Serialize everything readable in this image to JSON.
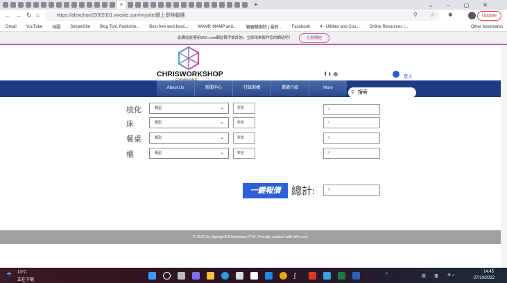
{
  "browser": {
    "url": "https://alexchan20002001.wixsite.com/mysite/網上即時報價",
    "update_label": "Update",
    "bookmarks": [
      "Gmail",
      "YouTube",
      "地圖",
      "SimpleSite",
      "Blog Tool, Publishin...",
      "Best free web hosti...",
      "WAMP, MAMP and...",
      "審審雙劇院 | 最新...",
      "Facebook",
      "4 - Utilities and Cou...",
      "Online Resources |..."
    ],
    "other_bookmarks": "Other bookmarks"
  },
  "wix_banner": {
    "text": "此網站是使用WIX.com網站幫手設計的。立即用來製作您的網站吧！",
    "button": "立即開始"
  },
  "site": {
    "logo": "CHRISWORKSHOP",
    "logo_sub": "ChrisWorkShop",
    "login": "登入",
    "menu": [
      "About Us",
      "新聞中心",
      "行政架構",
      "業績介紹",
      "More"
    ],
    "search_placeholder": "搜索"
  },
  "form": {
    "rows": [
      {
        "label": "梳化",
        "type": "類型",
        "qty": "數量",
        "price": "0"
      },
      {
        "label": "床",
        "type": "類型",
        "qty": "數量",
        "price": "0"
      },
      {
        "label": "餐桌",
        "type": "類型",
        "qty": "數量",
        "price": "0"
      },
      {
        "label": "櫃",
        "type": "類型",
        "qty": "數量",
        "price": "0"
      }
    ],
    "quote_button": "一鍵報價",
    "total_label": "總計:",
    "total": "0"
  },
  "footer": "© 2023 by Springhill Elementary PTA. Proudly created with Wix.com",
  "taskbar": {
    "weather_temp": "13°C",
    "weather_desc": "正在下雨",
    "ime1": "英",
    "ime2": "速",
    "time": "14:45",
    "date": "27/10/2022"
  }
}
